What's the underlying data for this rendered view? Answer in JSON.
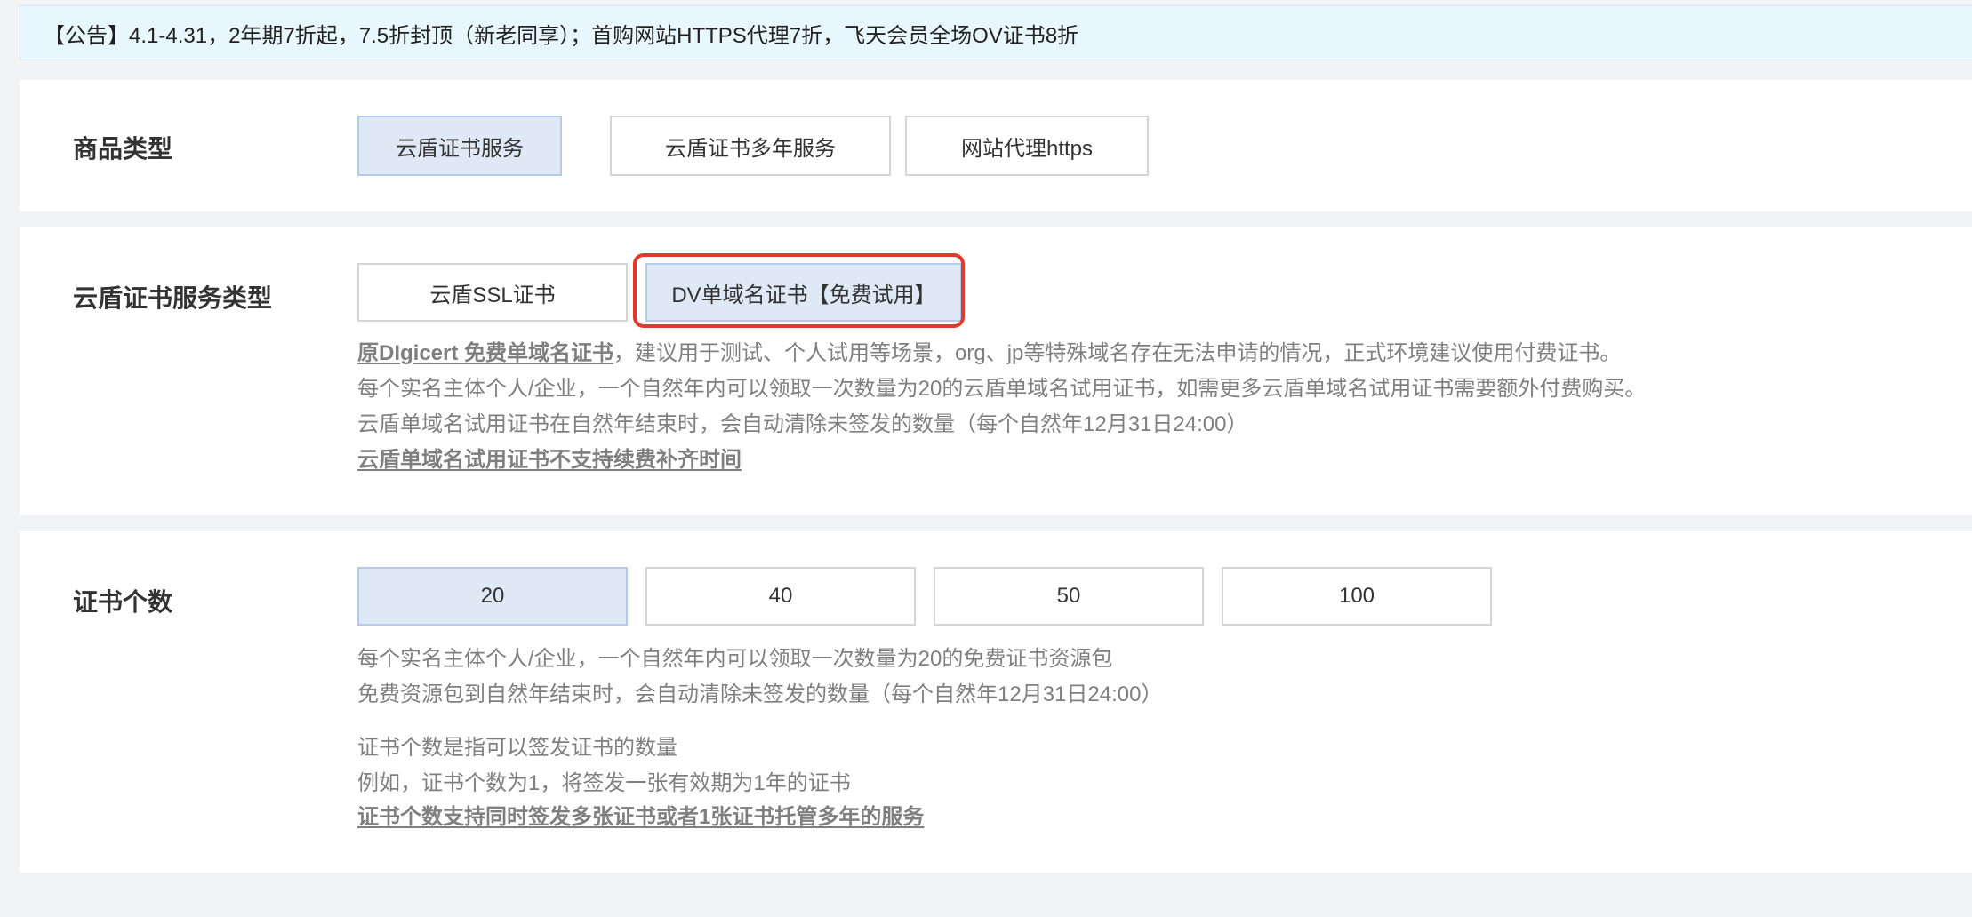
{
  "notice": {
    "text": "【公告】4.1-4.31，2年期7折起，7.5折封顶（新老同享）；首购网站HTTPS代理7折，飞天会员全场OV证书8折"
  },
  "product_type": {
    "label": "商品类型",
    "options": [
      {
        "label": "云盾证书服务",
        "selected": true
      },
      {
        "label": "云盾证书多年服务",
        "selected": false
      },
      {
        "label": "网站代理https",
        "selected": false
      }
    ]
  },
  "service_type": {
    "label": "云盾证书服务类型",
    "options": [
      {
        "label": "云盾SSL证书",
        "selected": false
      },
      {
        "label": "DV单域名证书【免费试用】",
        "selected": true
      }
    ],
    "desc": {
      "line1_link": "原DIgicert 免费单域名证书",
      "line1_rest": "，建议用于测试、个人试用等场景，org、jp等特殊域名存在无法申请的情况，正式环境建议使用付费证书。",
      "line2": "每个实名主体个人/企业，一个自然年内可以领取一次数量为20的云盾单域名试用证书，如需更多云盾单域名试用证书需要额外付费购买。",
      "line3": "云盾单域名试用证书在自然年结束时，会自动清除未签发的数量（每个自然年12月31日24:00）",
      "line4_link": "云盾单域名试用证书不支持续费补齐时间"
    }
  },
  "cert_count": {
    "label": "证书个数",
    "options": [
      {
        "label": "20",
        "selected": true
      },
      {
        "label": "40",
        "selected": false
      },
      {
        "label": "50",
        "selected": false
      },
      {
        "label": "100",
        "selected": false
      }
    ],
    "desc": {
      "line1": "每个实名主体个人/企业，一个自然年内可以领取一次数量为20的免费证书资源包",
      "line2": "免费资源包到自然年结束时，会自动清除未签发的数量（每个自然年12月31日24:00）",
      "line3": "证书个数是指可以签发证书的数量",
      "line4": "例如，证书个数为1，将签发一张有效期为1年的证书",
      "line5_link": "证书个数支持同时签发多张证书或者1张证书托管多年的服务"
    }
  },
  "colors": {
    "selected_bg": "#dfe9f6",
    "highlight": "#e0392d",
    "notice_bg": "#e8f7fd"
  }
}
